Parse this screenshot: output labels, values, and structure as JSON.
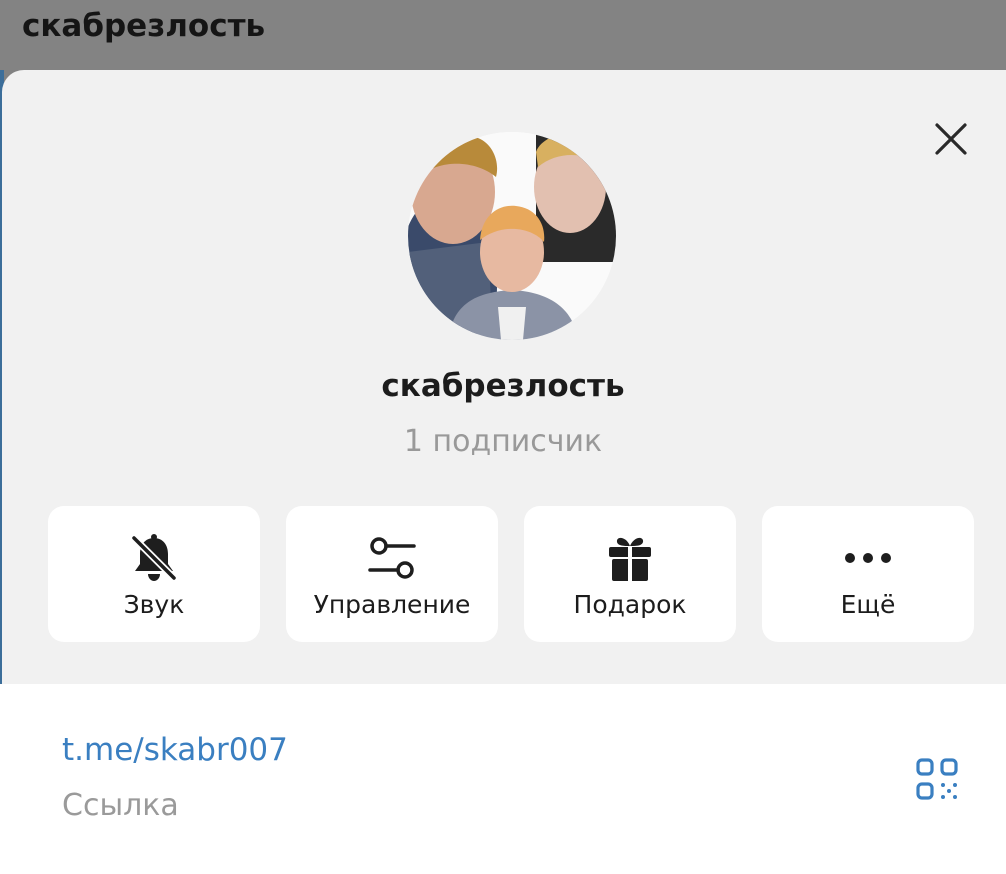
{
  "header": {
    "title": "скабрезлость"
  },
  "profile": {
    "name": "скабрезлость",
    "subscribers": "1 подписчик"
  },
  "actions": [
    {
      "label": "Звук",
      "icon": "bell-muted-icon"
    },
    {
      "label": "Управление",
      "icon": "sliders-icon"
    },
    {
      "label": "Подарок",
      "icon": "gift-icon"
    },
    {
      "label": "Ещё",
      "icon": "more-dots-icon"
    }
  ],
  "info": {
    "link": "t.me/skabr007",
    "link_caption": "Ссылка"
  },
  "colors": {
    "accent": "#3a7fc1",
    "modal_bg": "#f1f1f1",
    "overlay": "#838383"
  }
}
